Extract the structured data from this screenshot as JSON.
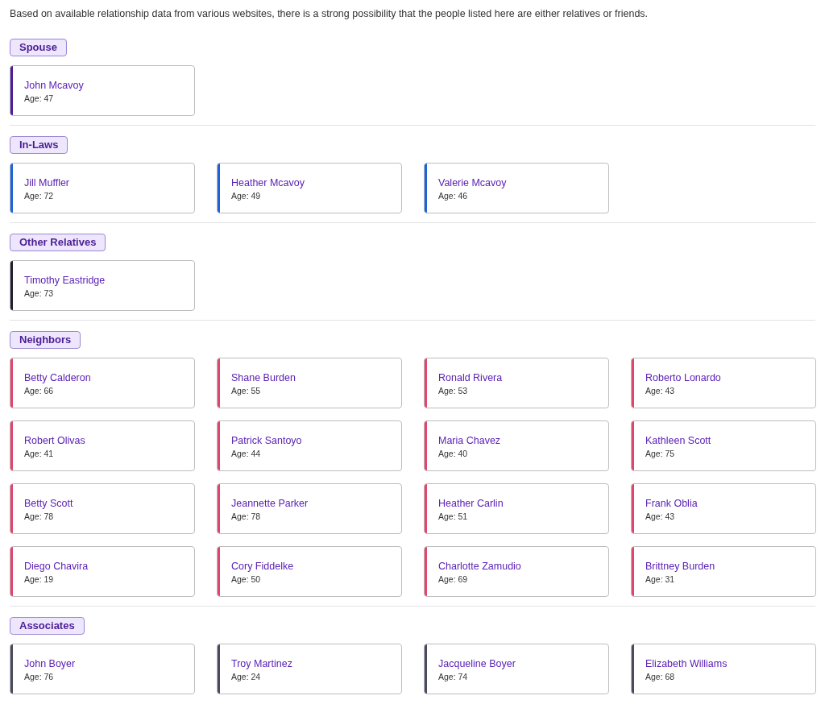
{
  "intro": "Based on available relationship data from various websites, there is a strong possibility that the people listed here are either relatives or friends.",
  "sections": [
    {
      "label": "Spouse",
      "people": [
        {
          "name": "John Mcavoy",
          "age": "Age: 47",
          "color": "#4c1d95"
        }
      ]
    },
    {
      "label": "In-Laws",
      "people": [
        {
          "name": "Jill Muffler",
          "age": "Age: 72",
          "color": "#1d63d6"
        },
        {
          "name": "Heather Mcavoy",
          "age": "Age: 49",
          "color": "#1d63d6"
        },
        {
          "name": "Valerie Mcavoy",
          "age": "Age: 46",
          "color": "#1d63d6"
        }
      ]
    },
    {
      "label": "Other Relatives",
      "people": [
        {
          "name": "Timothy Eastridge",
          "age": "Age: 73",
          "color": "#1f1f2e"
        }
      ]
    },
    {
      "label": "Neighbors",
      "people": [
        {
          "name": "Betty Calderon",
          "age": "Age: 66",
          "color": "#e0456e"
        },
        {
          "name": "Shane Burden",
          "age": "Age: 55",
          "color": "#e0456e"
        },
        {
          "name": "Ronald Rivera",
          "age": "Age: 53",
          "color": "#e0456e"
        },
        {
          "name": "Roberto Lonardo",
          "age": "Age: 43",
          "color": "#e0456e"
        },
        {
          "name": "Robert Olivas",
          "age": "Age: 41",
          "color": "#e0456e"
        },
        {
          "name": "Patrick Santoyo",
          "age": "Age: 44",
          "color": "#e0456e"
        },
        {
          "name": "Maria Chavez",
          "age": "Age: 40",
          "color": "#e0456e"
        },
        {
          "name": "Kathleen Scott",
          "age": "Age: 75",
          "color": "#e0456e"
        },
        {
          "name": "Betty Scott",
          "age": "Age: 78",
          "color": "#e0456e"
        },
        {
          "name": "Jeannette Parker",
          "age": "Age: 78",
          "color": "#e0456e"
        },
        {
          "name": "Heather Carlin",
          "age": "Age: 51",
          "color": "#e0456e"
        },
        {
          "name": "Frank Oblia",
          "age": "Age: 43",
          "color": "#e0456e"
        },
        {
          "name": "Diego Chavira",
          "age": "Age: 19",
          "color": "#e0456e"
        },
        {
          "name": "Cory Fiddelke",
          "age": "Age: 50",
          "color": "#e0456e"
        },
        {
          "name": "Charlotte Zamudio",
          "age": "Age: 69",
          "color": "#e0456e"
        },
        {
          "name": "Brittney Burden",
          "age": "Age: 31",
          "color": "#e0456e"
        }
      ]
    },
    {
      "label": "Associates",
      "people": [
        {
          "name": "John Boyer",
          "age": "Age: 76",
          "color": "#4a4a5e"
        },
        {
          "name": "Troy Martinez",
          "age": "Age: 24",
          "color": "#4a4a5e"
        },
        {
          "name": "Jacqueline Boyer",
          "age": "Age: 74",
          "color": "#4a4a5e"
        },
        {
          "name": "Elizabeth Williams",
          "age": "Age: 68",
          "color": "#4a4a5e"
        }
      ]
    }
  ]
}
